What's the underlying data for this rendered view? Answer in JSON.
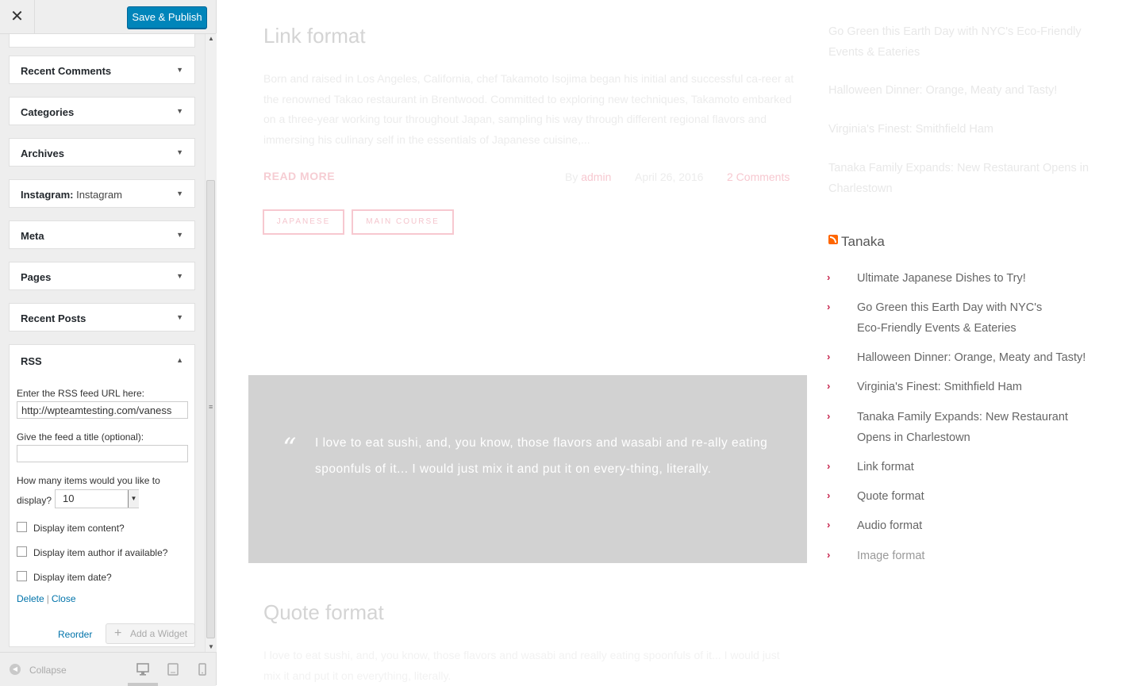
{
  "header": {
    "close_glyph": "✕",
    "save_label": "Save & Publish"
  },
  "widgets": {
    "recent_comments": "Recent Comments",
    "categories": "Categories",
    "archives": "Archives",
    "instagram_title": "Instagram:",
    "instagram_sub": "Instagram",
    "meta": "Meta",
    "pages": "Pages",
    "recent_posts": "Recent Posts",
    "rss": "RSS"
  },
  "rss_form": {
    "url_label": "Enter the RSS feed URL here:",
    "url_value": "http://wpteamtesting.com/vaness",
    "title_label": "Give the feed a title (optional):",
    "title_value": "",
    "count_label_1": "How many items would you like to",
    "count_label_2": "display?",
    "count_value": "10",
    "show_content": "Display item content?",
    "show_author": "Display item author if available?",
    "show_date": "Display item date?",
    "delete": "Delete",
    "pipe": "|",
    "close": "Close"
  },
  "footer": {
    "reorder": "Reorder",
    "add_widget": "Add a Widget",
    "collapse": "Collapse"
  },
  "preview": {
    "post1_title": "Link format",
    "post1_excerpt": "Born and raised in Los Angeles, California, chef Takamoto Isojima began his initial and successful ca-reer at the renowned Takao restaurant in Brentwood. Committed to exploring new techniques, Takamoto embarked on a three-year working tour throughout Japan, sampling his way through different regional flavors and immersing his culinary self in the essentials of Japanese cuisine,...",
    "read_more": "READ MORE",
    "by": "By",
    "author": "admin",
    "date": "April 26, 2016",
    "comments": "2 Comments",
    "tag1": "JAPANESE",
    "tag2": "MAIN COURSE",
    "quote_mark": "“",
    "quote": "I love to eat sushi, and, you know, those flavors and wasabi and re-ally eating spoonfuls of it... I would just mix it and put it on every-thing, literally.",
    "post2_title": "Quote format",
    "post2_excerpt": "I love to eat sushi, and, you know, those flavors and wasabi and really eating spoonfuls of it... I would just mix it and put it on everything, literally."
  },
  "sidebar_preview": {
    "top_links": [
      "Go Green this Earth Day with NYC's Eco-Friendly Events & Eateries",
      "Halloween Dinner: Orange, Meaty and Tasty!",
      "Virginia's Finest: Smithfield Ham",
      "Tanaka Family Expands: New Restaurant Opens in Charlestown"
    ],
    "rss_title": "Tanaka",
    "rss_items": [
      "Ultimate Japanese Dishes to Try!",
      "Go Green this Earth Day with NYC's Eco-Friendly Events & Eateries",
      "Halloween Dinner: Orange, Meaty and Tasty!",
      "Virginia's Finest: Smithfield Ham",
      "Tanaka Family Expands: New Restaurant Opens in Charlestown",
      "Link format",
      "Quote format",
      "Audio format",
      "Image format"
    ],
    "chevron": "›"
  },
  "colors": {
    "accent": "#0085ba",
    "link": "#0073aa",
    "pink": "#c7254e",
    "quote_bg": "#d2d2d2"
  }
}
